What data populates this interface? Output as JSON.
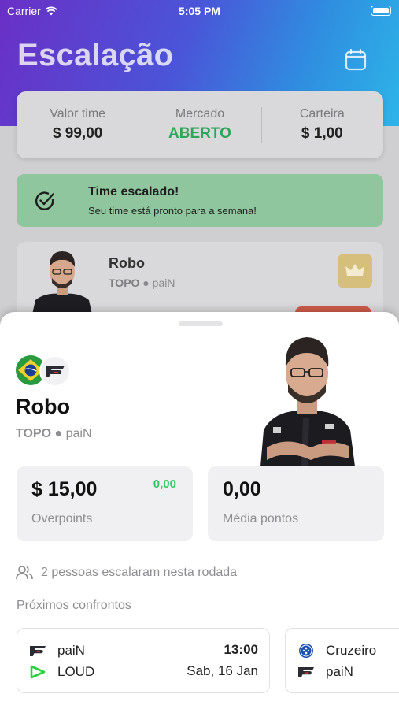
{
  "status_bar": {
    "carrier": "Carrier",
    "time": "5:05 PM"
  },
  "header": {
    "title": "Escalação"
  },
  "summary": {
    "team_value_label": "Valor time",
    "team_value": "$ 99,00",
    "market_label": "Mercado",
    "market_value": "ABERTO",
    "wallet_label": "Carteira",
    "wallet_value": "$ 1,00"
  },
  "banner": {
    "title": "Time escalado!",
    "subtitle": "Seu time está pronto para a semana!"
  },
  "background_player": {
    "name": "Robo",
    "role": "TOPO",
    "team": "paiN"
  },
  "sheet": {
    "player_name": "Robo",
    "role": "TOPO",
    "team": "paiN",
    "price_value": "$ 15,00",
    "price_delta": "0,00",
    "price_label": "Overpoints",
    "avg_value": "0,00",
    "avg_label": "Média pontos",
    "people_text": "2 pessoas escalaram nesta rodada",
    "next_matches_title": "Próximos confrontos",
    "matches": [
      {
        "team1": "paiN",
        "team2": "LOUD",
        "time": "13:00",
        "date": "Sab, 16 Jan"
      },
      {
        "team1": "Cruzeiro",
        "team2": "paiN"
      }
    ]
  },
  "icons": {
    "calendar": "calendar-icon",
    "check": "check-circle-icon",
    "crown": "crown-icon",
    "people": "people-icon",
    "flag": "brazil-flag-icon",
    "pain_logo": "pain-logo-icon",
    "loud_logo": "loud-logo-icon",
    "cruzeiro_logo": "cruzeiro-logo-icon"
  },
  "colors": {
    "header_gradient_start": "#6a2fc6",
    "header_gradient_end": "#2db4e8",
    "market_open": "#2ea55a",
    "success_banner": "#8fc69d",
    "delta_green": "#2ecb6a",
    "crown_button": "#d6bf7c",
    "remove_button": "#cf5c4b"
  }
}
